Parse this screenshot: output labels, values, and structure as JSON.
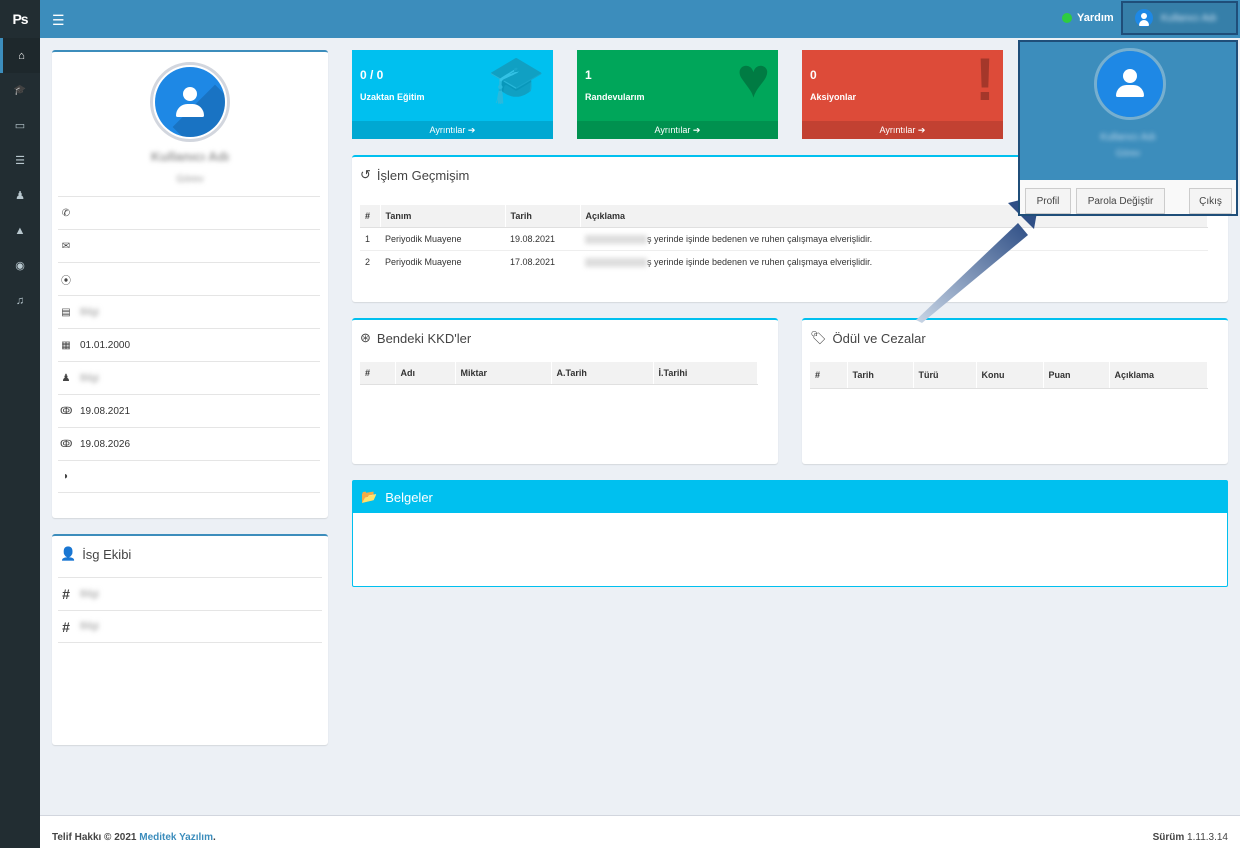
{
  "app": {
    "logo": "Ps",
    "help_label": "Yardım",
    "user_name": "Kullanıcı Adı"
  },
  "sidebar": {
    "items": [
      {
        "icon": "home-icon",
        "glyph": "⌂"
      },
      {
        "icon": "graduation-cap-icon",
        "glyph": "🎓"
      },
      {
        "icon": "desktop-icon",
        "glyph": "▭"
      },
      {
        "icon": "list-icon",
        "glyph": "☰"
      },
      {
        "icon": "user-md-icon",
        "glyph": "♟"
      },
      {
        "icon": "warning-icon",
        "glyph": "▲"
      },
      {
        "icon": "target-icon",
        "glyph": "◉"
      },
      {
        "icon": "bell-icon",
        "glyph": "♫"
      }
    ]
  },
  "profile": {
    "name": "Kullanıcı Adı",
    "subtitle": "Görev",
    "rows": [
      {
        "icon": "phone-icon",
        "glyph": "✆",
        "value": ""
      },
      {
        "icon": "envelope-icon",
        "glyph": "✉",
        "value": ""
      },
      {
        "icon": "map-marker-icon",
        "glyph": "⦿",
        "value": ""
      },
      {
        "icon": "building-icon",
        "glyph": "▤",
        "value": "Bilgi"
      },
      {
        "icon": "calendar-icon",
        "glyph": "▦",
        "value": "01.01.2000"
      },
      {
        "icon": "user-md-icon",
        "glyph": "♟",
        "value": "Bilgi"
      },
      {
        "icon": "stethoscope-icon",
        "glyph": "ↂ",
        "value": "19.08.2021"
      },
      {
        "icon": "stethoscope-icon",
        "glyph": "ↂ",
        "value": "19.08.2026"
      },
      {
        "icon": "shield-icon",
        "glyph": "◗",
        "value": ""
      }
    ]
  },
  "isg": {
    "title": "İsg Ekibi",
    "rows": [
      {
        "glyph": "#",
        "value": "Bilgi"
      },
      {
        "glyph": "#",
        "value": "Bilgi"
      }
    ]
  },
  "tiles": [
    {
      "value": "0 / 0",
      "label": "Uzaktan Eğitim",
      "footer": "Ayrıntılar ➔",
      "color": "#00c0ef",
      "icon": "graduation-cap-icon",
      "glyph": "🎓"
    },
    {
      "value": "1",
      "label": "Randevularım",
      "footer": "Ayrıntılar ➔",
      "color": "#00a65a",
      "icon": "heart-icon",
      "glyph": "♥"
    },
    {
      "value": "0",
      "label": "Aksiyonlar",
      "footer": "Ayrıntılar ➔",
      "color": "#dd4b39",
      "icon": "exclamation-icon",
      "glyph": "!"
    }
  ],
  "history": {
    "title": "İşlem Geçmişim",
    "columns": [
      "#",
      "Tanım",
      "Tarih",
      "Açıklama"
    ],
    "rows": [
      {
        "no": "1",
        "name": "Periyodik Muayene",
        "date": "19.08.2021",
        "desc": "ş yerinde işinde bedenen ve ruhen çalışmaya elverişlidir."
      },
      {
        "no": "2",
        "name": "Periyodik Muayene",
        "date": "17.08.2021",
        "desc": "ş yerinde işinde bedenen ve ruhen çalışmaya elverişlidir."
      }
    ]
  },
  "kkd": {
    "title": "Bendeki KKD'ler",
    "columns": [
      "#",
      "Adı",
      "Miktar",
      "A.Tarih",
      "İ.Tarihi"
    ]
  },
  "awards": {
    "title": "Ödül ve Cezalar",
    "columns": [
      "#",
      "Tarih",
      "Türü",
      "Konu",
      "Puan",
      "Açıklama"
    ]
  },
  "documents": {
    "title": "Belgeler"
  },
  "dropdown": {
    "name": "Kullanıcı Adı",
    "subtitle": "Görev",
    "profile_button": "Profil",
    "password_button": "Parola Değiştir",
    "logout_button": "Çıkış"
  },
  "footer": {
    "copyright": "Telif Hakkı © 2021 ",
    "company": "Meditek Yazılım",
    "period": ".",
    "version_label": "Sürüm",
    "version": "1.11.3.14"
  }
}
